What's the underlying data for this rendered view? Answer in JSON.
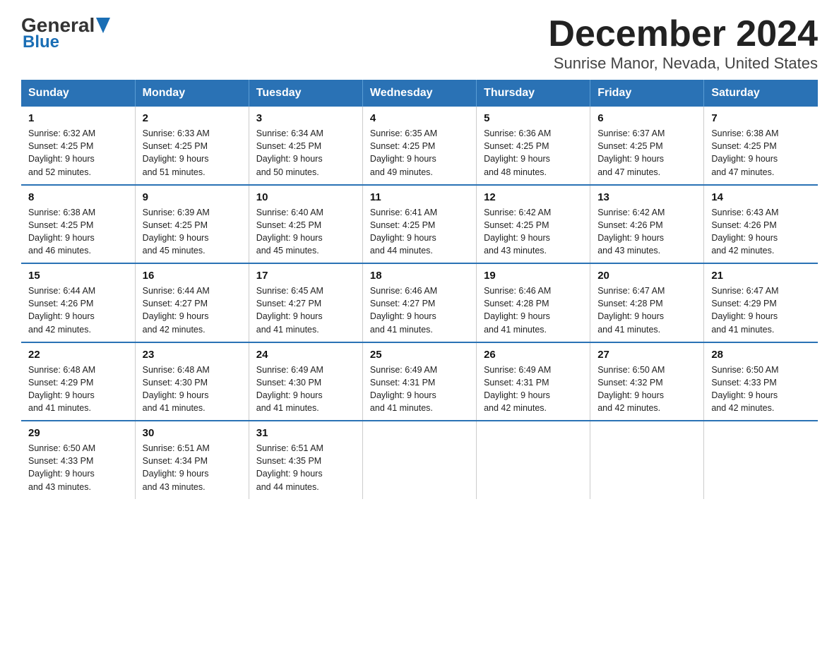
{
  "header": {
    "logo_general": "General",
    "logo_blue": "Blue",
    "title": "December 2024",
    "subtitle": "Sunrise Manor, Nevada, United States"
  },
  "weekdays": [
    "Sunday",
    "Monday",
    "Tuesday",
    "Wednesday",
    "Thursday",
    "Friday",
    "Saturday"
  ],
  "weeks": [
    [
      {
        "day": "1",
        "sunrise": "6:32 AM",
        "sunset": "4:25 PM",
        "daylight": "9 hours and 52 minutes."
      },
      {
        "day": "2",
        "sunrise": "6:33 AM",
        "sunset": "4:25 PM",
        "daylight": "9 hours and 51 minutes."
      },
      {
        "day": "3",
        "sunrise": "6:34 AM",
        "sunset": "4:25 PM",
        "daylight": "9 hours and 50 minutes."
      },
      {
        "day": "4",
        "sunrise": "6:35 AM",
        "sunset": "4:25 PM",
        "daylight": "9 hours and 49 minutes."
      },
      {
        "day": "5",
        "sunrise": "6:36 AM",
        "sunset": "4:25 PM",
        "daylight": "9 hours and 48 minutes."
      },
      {
        "day": "6",
        "sunrise": "6:37 AM",
        "sunset": "4:25 PM",
        "daylight": "9 hours and 47 minutes."
      },
      {
        "day": "7",
        "sunrise": "6:38 AM",
        "sunset": "4:25 PM",
        "daylight": "9 hours and 47 minutes."
      }
    ],
    [
      {
        "day": "8",
        "sunrise": "6:38 AM",
        "sunset": "4:25 PM",
        "daylight": "9 hours and 46 minutes."
      },
      {
        "day": "9",
        "sunrise": "6:39 AM",
        "sunset": "4:25 PM",
        "daylight": "9 hours and 45 minutes."
      },
      {
        "day": "10",
        "sunrise": "6:40 AM",
        "sunset": "4:25 PM",
        "daylight": "9 hours and 45 minutes."
      },
      {
        "day": "11",
        "sunrise": "6:41 AM",
        "sunset": "4:25 PM",
        "daylight": "9 hours and 44 minutes."
      },
      {
        "day": "12",
        "sunrise": "6:42 AM",
        "sunset": "4:25 PM",
        "daylight": "9 hours and 43 minutes."
      },
      {
        "day": "13",
        "sunrise": "6:42 AM",
        "sunset": "4:26 PM",
        "daylight": "9 hours and 43 minutes."
      },
      {
        "day": "14",
        "sunrise": "6:43 AM",
        "sunset": "4:26 PM",
        "daylight": "9 hours and 42 minutes."
      }
    ],
    [
      {
        "day": "15",
        "sunrise": "6:44 AM",
        "sunset": "4:26 PM",
        "daylight": "9 hours and 42 minutes."
      },
      {
        "day": "16",
        "sunrise": "6:44 AM",
        "sunset": "4:27 PM",
        "daylight": "9 hours and 42 minutes."
      },
      {
        "day": "17",
        "sunrise": "6:45 AM",
        "sunset": "4:27 PM",
        "daylight": "9 hours and 41 minutes."
      },
      {
        "day": "18",
        "sunrise": "6:46 AM",
        "sunset": "4:27 PM",
        "daylight": "9 hours and 41 minutes."
      },
      {
        "day": "19",
        "sunrise": "6:46 AM",
        "sunset": "4:28 PM",
        "daylight": "9 hours and 41 minutes."
      },
      {
        "day": "20",
        "sunrise": "6:47 AM",
        "sunset": "4:28 PM",
        "daylight": "9 hours and 41 minutes."
      },
      {
        "day": "21",
        "sunrise": "6:47 AM",
        "sunset": "4:29 PM",
        "daylight": "9 hours and 41 minutes."
      }
    ],
    [
      {
        "day": "22",
        "sunrise": "6:48 AM",
        "sunset": "4:29 PM",
        "daylight": "9 hours and 41 minutes."
      },
      {
        "day": "23",
        "sunrise": "6:48 AM",
        "sunset": "4:30 PM",
        "daylight": "9 hours and 41 minutes."
      },
      {
        "day": "24",
        "sunrise": "6:49 AM",
        "sunset": "4:30 PM",
        "daylight": "9 hours and 41 minutes."
      },
      {
        "day": "25",
        "sunrise": "6:49 AM",
        "sunset": "4:31 PM",
        "daylight": "9 hours and 41 minutes."
      },
      {
        "day": "26",
        "sunrise": "6:49 AM",
        "sunset": "4:31 PM",
        "daylight": "9 hours and 42 minutes."
      },
      {
        "day": "27",
        "sunrise": "6:50 AM",
        "sunset": "4:32 PM",
        "daylight": "9 hours and 42 minutes."
      },
      {
        "day": "28",
        "sunrise": "6:50 AM",
        "sunset": "4:33 PM",
        "daylight": "9 hours and 42 minutes."
      }
    ],
    [
      {
        "day": "29",
        "sunrise": "6:50 AM",
        "sunset": "4:33 PM",
        "daylight": "9 hours and 43 minutes."
      },
      {
        "day": "30",
        "sunrise": "6:51 AM",
        "sunset": "4:34 PM",
        "daylight": "9 hours and 43 minutes."
      },
      {
        "day": "31",
        "sunrise": "6:51 AM",
        "sunset": "4:35 PM",
        "daylight": "9 hours and 44 minutes."
      },
      null,
      null,
      null,
      null
    ]
  ]
}
